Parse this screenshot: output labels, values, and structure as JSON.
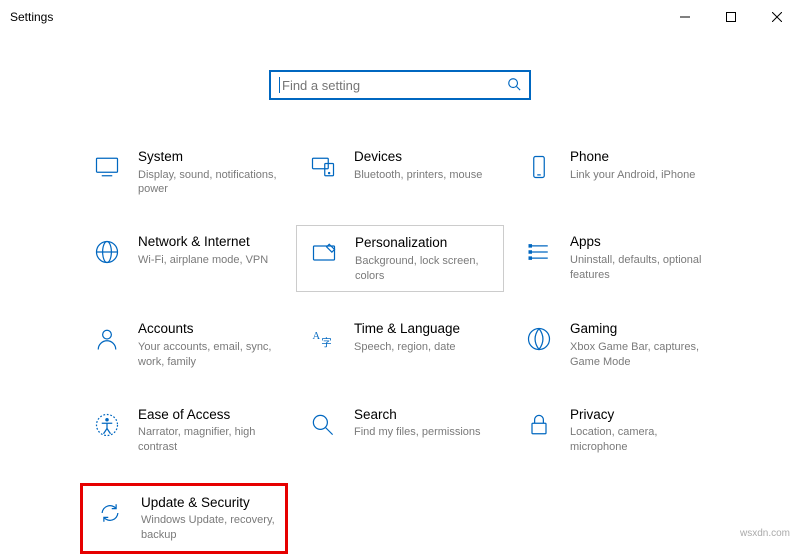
{
  "window": {
    "title": "Settings"
  },
  "search": {
    "placeholder": "Find a setting"
  },
  "tiles": {
    "system": {
      "title": "System",
      "desc": "Display, sound, notifications, power"
    },
    "devices": {
      "title": "Devices",
      "desc": "Bluetooth, printers, mouse"
    },
    "phone": {
      "title": "Phone",
      "desc": "Link your Android, iPhone"
    },
    "network": {
      "title": "Network & Internet",
      "desc": "Wi-Fi, airplane mode, VPN"
    },
    "personalization": {
      "title": "Personalization",
      "desc": "Background, lock screen, colors"
    },
    "apps": {
      "title": "Apps",
      "desc": "Uninstall, defaults, optional features"
    },
    "accounts": {
      "title": "Accounts",
      "desc": "Your accounts, email, sync, work, family"
    },
    "time": {
      "title": "Time & Language",
      "desc": "Speech, region, date"
    },
    "gaming": {
      "title": "Gaming",
      "desc": "Xbox Game Bar, captures, Game Mode"
    },
    "ease": {
      "title": "Ease of Access",
      "desc": "Narrator, magnifier, high contrast"
    },
    "searchcat": {
      "title": "Search",
      "desc": "Find my files, permissions"
    },
    "privacy": {
      "title": "Privacy",
      "desc": "Location, camera, microphone"
    },
    "update": {
      "title": "Update & Security",
      "desc": "Windows Update, recovery, backup"
    }
  },
  "watermark": "wsxdn.com"
}
